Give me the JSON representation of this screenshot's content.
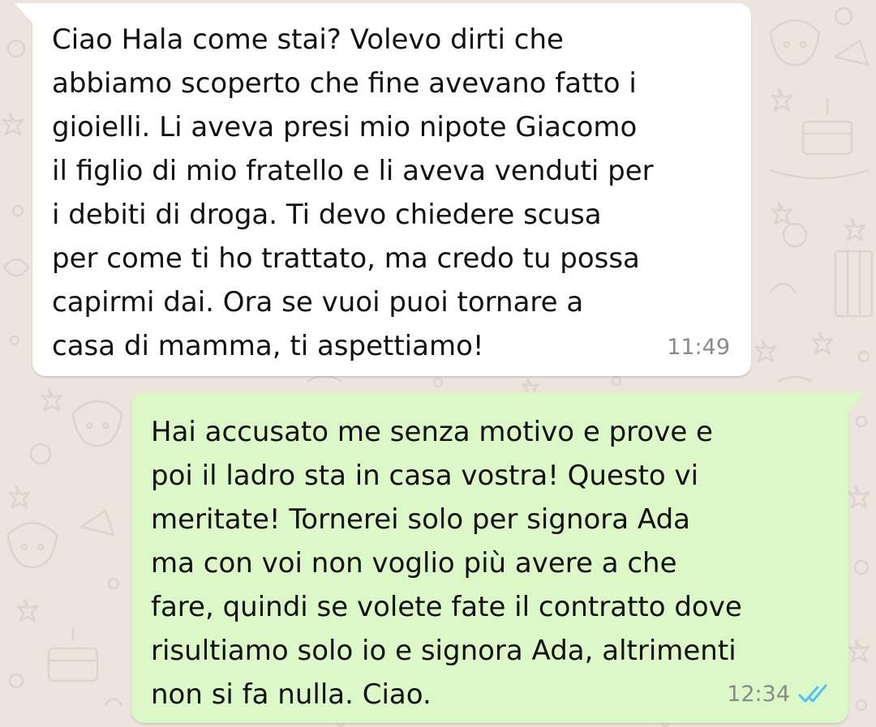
{
  "conversation": {
    "messages": [
      {
        "direction": "incoming",
        "text": "Ciao Hala come stai? Volevo dirti che\nabbiamo scoperto che fine avevano fatto i\ngioielli. Li aveva presi mio nipote Giacomo\nil figlio di mio fratello e li aveva venduti per\ni debiti di droga. Ti devo chiedere scusa\nper come ti ho trattato, ma credo tu possa\ncapirmi dai. Ora se vuoi puoi tornare a\ncasa di mamma, ti aspettiamo!",
        "time": "11:49"
      },
      {
        "direction": "outgoing",
        "text": "Hai accusato me senza motivo e prove e\npoi il ladro sta in casa vostra! Questo vi\nmeritate! Tornerei solo per signora Ada\nma con voi non voglio più avere a che\nfare, quindi se volete fate il contratto dove\nrisultiamo solo io e signora Ada, altrimenti\nnon si fa nulla. Ciao.",
        "time": "12:34",
        "status_icon": "double-check-read-icon"
      }
    ]
  },
  "colors": {
    "background": "#ece5dd",
    "incoming_bubble": "#ffffff",
    "outgoing_bubble": "#dcf8c6",
    "timestamp": "#8a8a8a",
    "read_ticks": "#4fc3f7"
  }
}
